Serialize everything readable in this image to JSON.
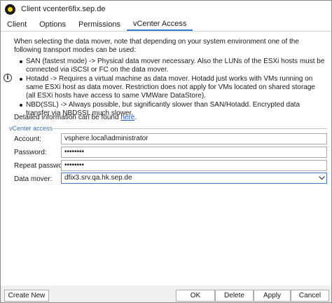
{
  "window": {
    "title": "Client vcenter6fix.sep.de"
  },
  "tabs": [
    {
      "label": "Client"
    },
    {
      "label": "Options"
    },
    {
      "label": "Permissions"
    },
    {
      "label": "vCenter Access"
    }
  ],
  "active_tab": "vCenter Access",
  "info": {
    "intro": "When selecting the data mover, note that depending on your system environment one of the following transport modes can be used:",
    "bullets": [
      "SAN (fastest mode) -> Physical data mover necessary. Also the LUNs of the ESXi hosts must be connected via iSCSI or FC on the data mover.",
      "Hotadd -> Requires a virtual machine as data mover. Hotadd just works with VMs running on same ESXi host as data mover. Restriction does not apply for VMs located on shared storage (all ESXi hosts have access to same VMWare DataStore).",
      "NBD(SSL) -> Always possible, but significantly slower than SAN/Hotadd. Encrypted data transfer via NBDSSL much slower."
    ],
    "detail_prefix": "Detailed information can be found ",
    "detail_link": "here",
    "detail_suffix": "."
  },
  "vcenter_access": {
    "group_label": "vCenter access",
    "account_label": "Account:",
    "account_value": "vsphere.local\\administrator",
    "password_label": "Password:",
    "password_value": "••••••••",
    "repeat_password_label": "Repeat password:",
    "repeat_password_value": "••••••••",
    "data_mover_label": "Data mover:",
    "data_mover_value": "dfix3.srv.qa.hk.sep.de"
  },
  "buttons": {
    "create_new": "Create New",
    "ok": "OK",
    "delete": "Delete",
    "apply": "Apply",
    "cancel": "Cancel"
  },
  "colors": {
    "accent": "#3a7bd5",
    "link": "#1a56c4",
    "group_label": "#3a6fb0"
  }
}
